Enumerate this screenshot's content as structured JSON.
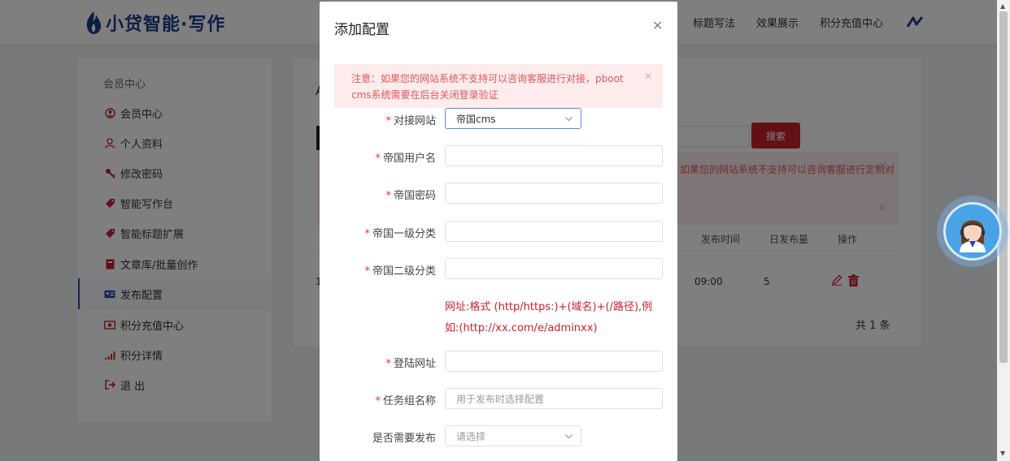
{
  "header": {
    "logo_text": "小贷智能·写作",
    "nav": [
      {
        "label": "标题写法"
      },
      {
        "label": "效果展示"
      },
      {
        "label": "积分充值中心"
      }
    ],
    "brand_color": "#1d3a8a",
    "accent_color": "#c8202f"
  },
  "sidebar": {
    "title": "会员中心",
    "items": [
      {
        "label": "会员中心",
        "icon": "user-circle-icon"
      },
      {
        "label": "个人资料",
        "icon": "person-icon"
      },
      {
        "label": "修改密码",
        "icon": "key-icon"
      },
      {
        "label": "智能写作台",
        "icon": "tag-icon"
      },
      {
        "label": "智能标题扩展",
        "icon": "tag-icon"
      },
      {
        "label": "文章库/批量创作",
        "icon": "book-icon"
      },
      {
        "label": "发布配置",
        "icon": "id-card-icon",
        "active": true
      },
      {
        "label": "积分充值中心",
        "icon": "money-icon"
      },
      {
        "label": "积分详情",
        "icon": "signal-icon"
      },
      {
        "label": "退 出",
        "icon": "logout-icon"
      }
    ]
  },
  "content": {
    "partial_heading": "A",
    "search_label": "搜索",
    "alert_partial": "如果您的网站系统不支持可以咨询客服进行定制对",
    "table": {
      "headers": [
        "发布时间",
        "日发布量",
        "操作"
      ],
      "row": {
        "num": "1",
        "time": "09:00",
        "count": "5"
      }
    },
    "total": "共 1 条"
  },
  "modal": {
    "title": "添加配置",
    "alert": "注意：如果您的网站系统不支持可以咨询客服进行对接，pboot cms系统需要在后台关闭登录验证",
    "fields": {
      "site": {
        "label": "对接网站",
        "value": "帝国cms"
      },
      "username": {
        "label": "帝国用户名",
        "value": ""
      },
      "password": {
        "label": "帝国密码",
        "value": ""
      },
      "cat1": {
        "label": "帝国一级分类",
        "value": ""
      },
      "cat2": {
        "label": "帝国二级分类",
        "value": ""
      },
      "hint": "网址:格式 (http/https:)+(域名)+(/路径),例如:(http://xx.com/e/adminxx)",
      "login_url": {
        "label": "登陆网址",
        "value": ""
      },
      "task_group": {
        "label": "任务组名称",
        "placeholder": "用于发布时选择配置"
      },
      "need_publish": {
        "label": "是否需要发布",
        "placeholder": "请选择"
      }
    }
  }
}
